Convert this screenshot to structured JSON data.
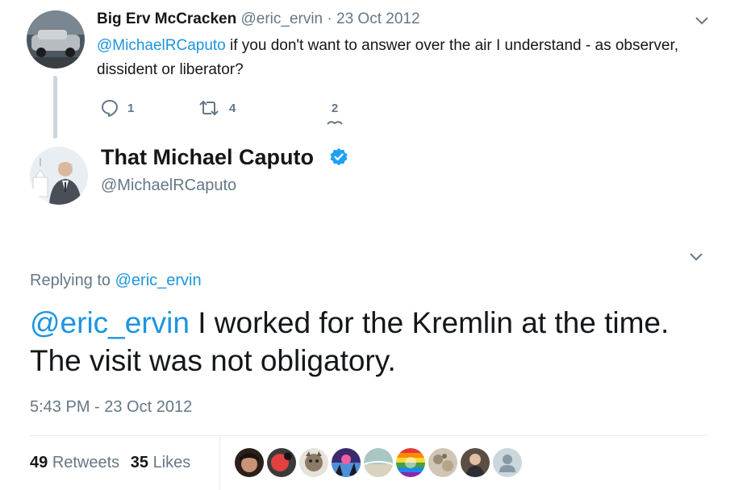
{
  "parent_tweet": {
    "display_name": "Big Erv McCracken",
    "handle": "@eric_ervin",
    "separator": "·",
    "date": "23 Oct 2012",
    "mention": "@MichaelRCaputo",
    "text": " if you don't want to answer over the air I understand - as observer, dissident or liberator?",
    "reply_count": "1",
    "retweet_count": "4",
    "like_count": "2"
  },
  "main_tweet": {
    "display_name": "That Michael Caputo",
    "handle": "@MichaelRCaputo",
    "replying_prefix": "Replying to ",
    "replying_to": "@eric_ervin",
    "mention": "@eric_ervin",
    "text": " I worked for the Kremlin at the time. The visit was not obligatory.",
    "timestamp": "5:43 PM - 23 Oct 2012",
    "retweets_count": "49",
    "retweets_label": "Retweets",
    "likes_count": "35",
    "likes_label": "Likes"
  },
  "colors": {
    "link": "#1b95e0",
    "muted": "#657786",
    "verified": "#1da1f2",
    "divider": "#e6ecf0",
    "thread_line": "#ccd6dd"
  },
  "icons": [
    "reply-icon",
    "retweet-icon",
    "like-icon",
    "chevron-down-icon",
    "verified-badge-icon",
    "default-avatar-icon"
  ]
}
